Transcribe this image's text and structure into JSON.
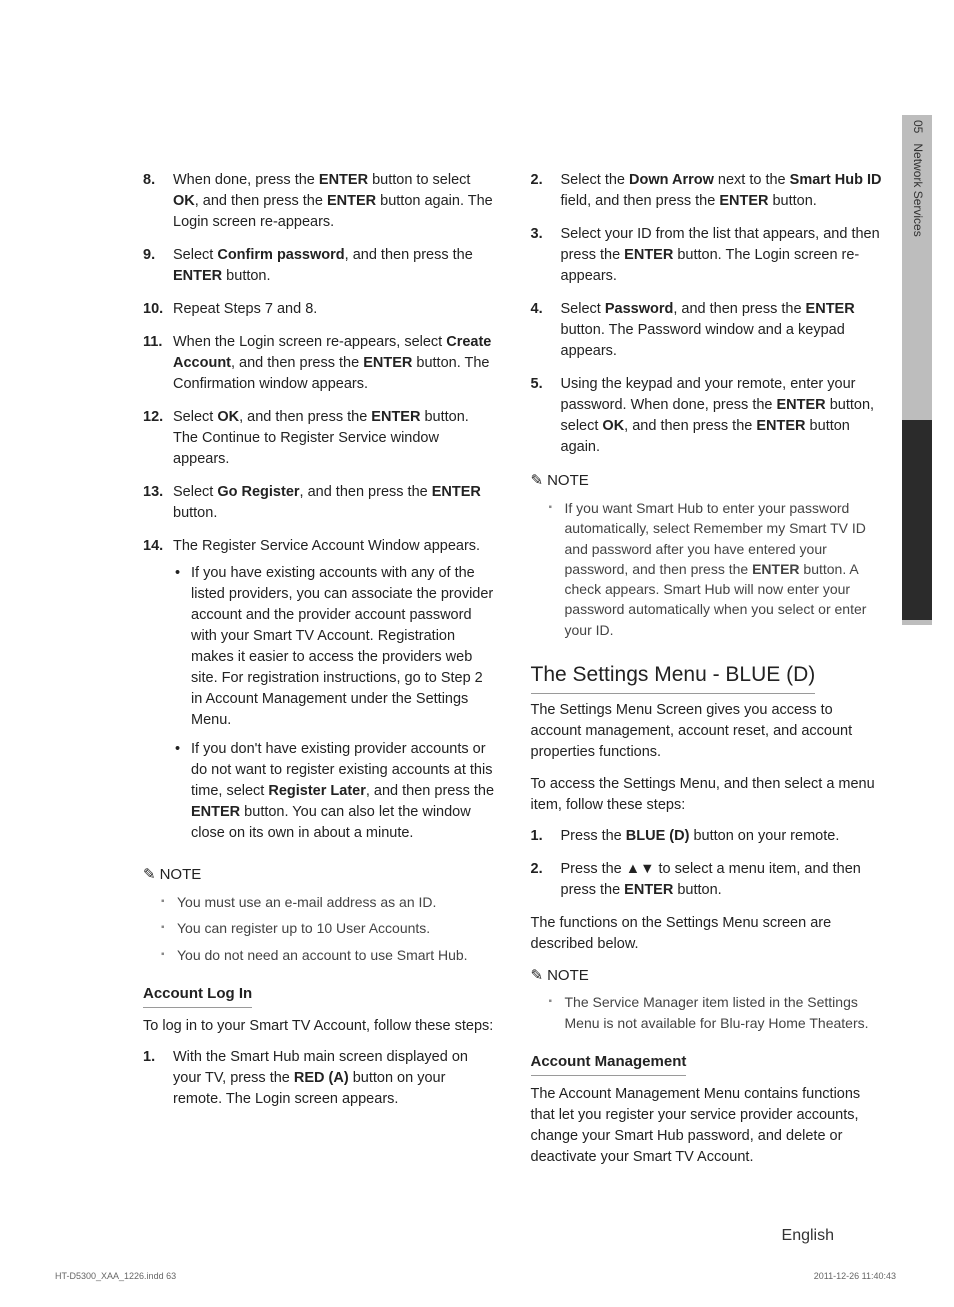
{
  "tab": {
    "num": "05",
    "label": "Network Services"
  },
  "col1": {
    "steps": [
      {
        "n": "8.",
        "html": "When done, press the <b>ENTER</b> button to select <b>OK</b>, and then press the <b>ENTER</b> button again. The Login screen re-appears."
      },
      {
        "n": "9.",
        "html": "Select <b>Confirm password</b>, and then press the <b>ENTER</b> button."
      },
      {
        "n": "10.",
        "html": "Repeat Steps 7 and 8."
      },
      {
        "n": "11.",
        "html": "When the Login screen re-appears, select <b>Create Account</b>, and then press the <b>ENTER</b> button. The Confirmation window appears."
      },
      {
        "n": "12.",
        "html": "Select <b>OK</b>, and then press the <b>ENTER</b> button. The Continue to Register Service window appears."
      },
      {
        "n": "13.",
        "html": "Select <b>Go Register</b>, and then press the <b>ENTER</b> button."
      },
      {
        "n": "14.",
        "html": "The Register Service Account Window appears.",
        "bullets": [
          "If you have existing accounts with any of the listed providers, you can associate the provider account and the provider account password with your Smart TV Account. Registration makes it easier to access the providers web site. For registration instructions, go to Step 2 in Account Management under the Settings Menu.",
          "If you don't have existing provider accounts or do not want to register existing accounts at this time, select <b>Register Later</b>, and then press the <b>ENTER</b> button. You can also let the window close on its own in about a minute."
        ]
      }
    ],
    "note_label": "NOTE",
    "notes": [
      "You must use an e-mail address as an ID.",
      "You can register up to 10 User Accounts.",
      "You do not need an account to use Smart Hub."
    ],
    "login_head": "Account Log In",
    "login_para": "To log in to your Smart TV Account, follow these steps:",
    "login_steps": [
      {
        "n": "1.",
        "html": "With the Smart Hub main screen displayed on your TV, press the <b>RED (A)</b> button on your remote. The Login screen appears."
      }
    ]
  },
  "col2": {
    "steps": [
      {
        "n": "2.",
        "html": "Select the <b>Down Arrow</b> next to the <b>Smart Hub ID</b> field, and then press the <b>ENTER</b> button."
      },
      {
        "n": "3.",
        "html": "Select your ID from the list that appears, and then press the <b>ENTER</b> button. The Login screen re-appears."
      },
      {
        "n": "4.",
        "html": "Select <b>Password</b>, and then press the <b>ENTER</b> button. The Password window and a keypad appears."
      },
      {
        "n": "5.",
        "html": "Using the keypad and your remote, enter your password. When done, press the <b>ENTER</b> button, select <b>OK</b>, and then press the <b>ENTER</b> button again."
      }
    ],
    "note_label": "NOTE",
    "notes": [
      "If you want Smart Hub to enter your password automatically, select Remember my Smart TV ID and password after you have entered your password, and then press the <b>ENTER</b> button. A check appears. Smart Hub will now enter your password automatically when you select or enter your ID."
    ],
    "settings_head": "The Settings Menu - BLUE (D)",
    "settings_p1": "The Settings Menu Screen gives you access to account management, account reset, and account properties functions.",
    "settings_p2": "To access the Settings Menu, and then select a menu item, follow these steps:",
    "settings_steps": [
      {
        "n": "1.",
        "html": "Press the <b>BLUE (D)</b> button on your remote."
      },
      {
        "n": "2.",
        "html": "Press the ▲▼ to select a menu item, and then press the <b>ENTER</b> button."
      }
    ],
    "settings_p3": "The functions on the Settings Menu screen are described below.",
    "note2_label": "NOTE",
    "notes2": [
      "The Service Manager item listed in the Settings Menu is not available for Blu-ray Home Theaters."
    ],
    "acct_head": "Account Management",
    "acct_para": "The Account Management Menu contains functions that let you register your service provider accounts, change your Smart Hub password, and delete or deactivate your Smart TV Account."
  },
  "footer": {
    "left": "HT-D5300_XAA_1226.indd   63",
    "right": "2011-12-26   11:40:43",
    "english": "English"
  }
}
